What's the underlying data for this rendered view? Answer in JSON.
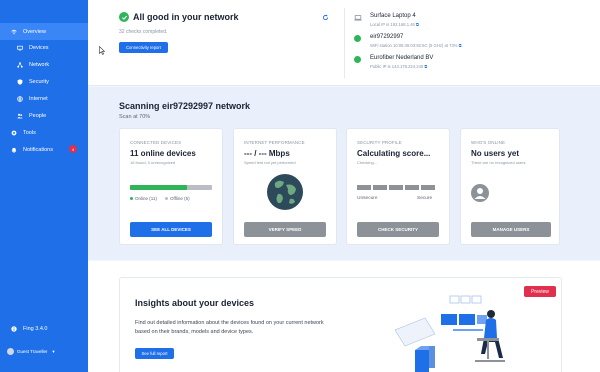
{
  "sidebar": {
    "items": [
      {
        "label": "Overview",
        "icon": "wifi-icon",
        "active": true
      },
      {
        "label": "Devices",
        "icon": "devices-icon"
      },
      {
        "label": "Network",
        "icon": "network-icon"
      },
      {
        "label": "Security",
        "icon": "shield-icon"
      },
      {
        "label": "Internet",
        "icon": "globe-icon"
      },
      {
        "label": "People",
        "icon": "people-icon"
      },
      {
        "label": "Tools",
        "icon": "tools-icon"
      },
      {
        "label": "Notifications",
        "icon": "bell-icon",
        "badge": "4"
      }
    ],
    "version": "Fing 3.4.0",
    "user_label": "Guest Traveller"
  },
  "status": {
    "title": "All good in your network",
    "subtitle": "32 checks completed.",
    "report_button": "Connectivity report"
  },
  "devices": [
    {
      "name": "Surface Laptop 4",
      "meta": "Local IP is 192.168.1.46"
    },
    {
      "name": "eir97292997",
      "meta": "WiFi station 10:06:45:03:82:6C (5 GHz) at 73%"
    },
    {
      "name": "Eurofiber Nederland BV",
      "meta": "Public IP is 144.178.224.240"
    }
  ],
  "scan": {
    "title": "Scanning eir97292997 network",
    "progress_text": "Scan at 70%"
  },
  "cards": {
    "connected": {
      "label": "CONNECTED DEVICES",
      "value": "11 online devices",
      "note": "16 found, 0 unrecognized",
      "online": "Online (11)",
      "offline": "Offline (5)",
      "online_fraction": 0.69,
      "button": "SEE ALL DEVICES"
    },
    "internet": {
      "label": "INTERNET PERFORMANCE",
      "value": "--- / --- Mbps",
      "note": "Speed test not yet performed",
      "button": "VERIFY SPEED"
    },
    "security": {
      "label": "SECURITY PROFILE",
      "value": "Calculating score...",
      "note": "Checking...",
      "low": "Unsecure",
      "high": "Secure",
      "button": "CHECK SECURITY"
    },
    "online": {
      "label": "WHO'S ONLINE",
      "value": "No users yet",
      "note": "There are no recognized users",
      "button": "MANAGE USERS"
    }
  },
  "insights": {
    "badge": "Preview",
    "title": "Insights about your devices",
    "text": "Find out detailed information about the devices found on your current network based on their brands, models and device types.",
    "button": "See full report"
  },
  "colors": {
    "sidebar": "#1f6fe8",
    "accent": "#1f6fe8",
    "success": "#2fb45a",
    "danger": "#e0304e"
  }
}
